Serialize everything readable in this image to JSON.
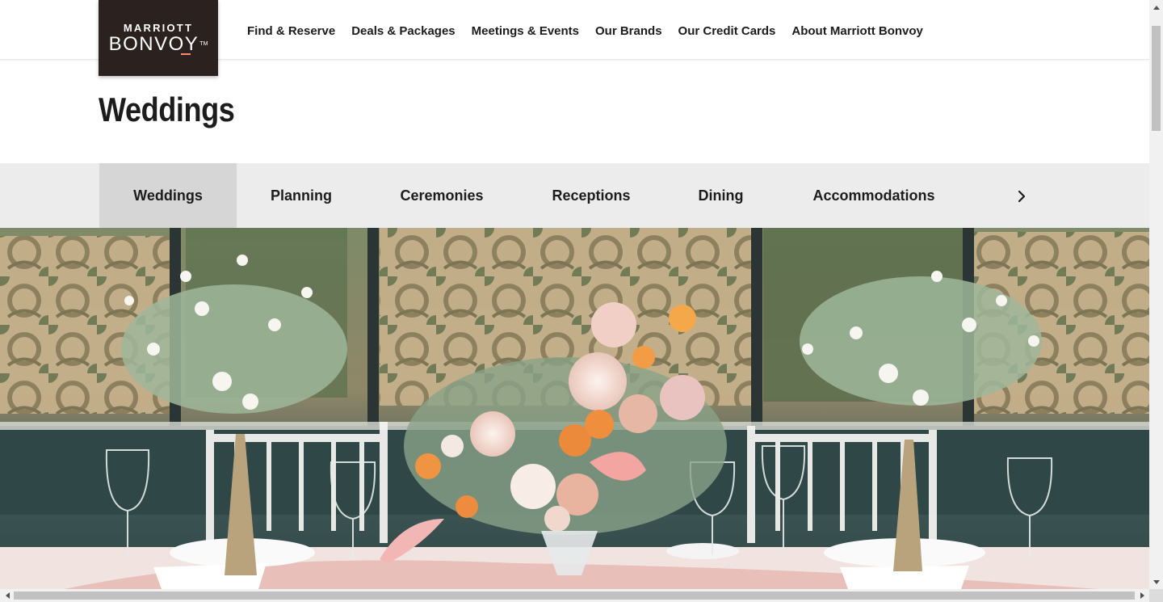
{
  "brand": {
    "line1": "MARRIOTT",
    "line2": "BONVOY",
    "trademark": "TM"
  },
  "nav": [
    "Find & Reserve",
    "Deals & Packages",
    "Meetings & Events",
    "Our Brands",
    "Our Credit Cards",
    "About Marriott Bonvoy"
  ],
  "page_title": "Weddings",
  "tabs": [
    {
      "label": "Weddings",
      "active": true
    },
    {
      "label": "Planning",
      "active": false
    },
    {
      "label": "Ceremonies",
      "active": false
    },
    {
      "label": "Receptions",
      "active": false
    },
    {
      "label": "Dining",
      "active": false
    },
    {
      "label": "Accommodations",
      "active": false
    }
  ],
  "tab_next_icon": "chevron-right-icon",
  "hero": {
    "subject": "wedding-table-floral-centerpiece"
  },
  "colors": {
    "logo_bg": "#2b2220",
    "logo_accent": "#ff8d6b",
    "tab_bar": "#ececec",
    "tab_active": "#d6d6d6"
  }
}
